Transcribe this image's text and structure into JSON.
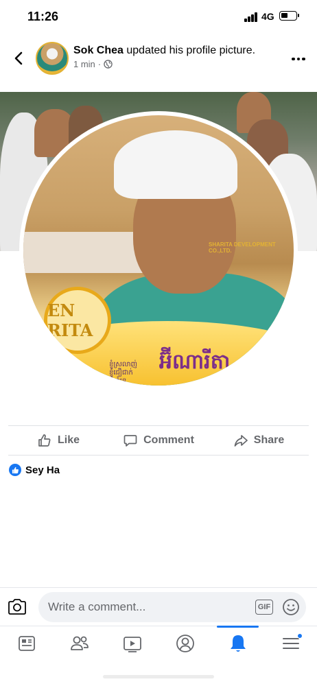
{
  "status_bar": {
    "time": "11:26",
    "network": "4G"
  },
  "post": {
    "author": "Sok Chea",
    "action_text": " updated his profile picture.",
    "time_ago": "1 min",
    "separator": "·",
    "privacy_icon": "globe-icon"
  },
  "photo": {
    "logo_text": "EN RITA",
    "tagline_lines": [
      "ខ្ញុំស្រលាញ់",
      "ខ្ញុំជឿជាក់",
      "ខ្ញុំគាំទ្រ"
    ],
    "brand": "អ៊ីណារីតា",
    "watermark": "SHARITA DEVELOPMENT CO.,LTD."
  },
  "actions": [
    {
      "label": "Like",
      "icon": "thumbs-up-icon"
    },
    {
      "label": "Comment",
      "icon": "comment-icon"
    },
    {
      "label": "Share",
      "icon": "share-icon"
    }
  ],
  "reactions": {
    "names": "Sey Ha",
    "icon": "like-badge-icon"
  },
  "comment": {
    "placeholder": "Write a comment...",
    "gif_label": "GIF"
  },
  "tabs": [
    {
      "icon": "news-feed-icon"
    },
    {
      "icon": "friends-icon"
    },
    {
      "icon": "watch-icon"
    },
    {
      "icon": "profile-icon"
    },
    {
      "icon": "notifications-bell-icon",
      "active": true
    },
    {
      "icon": "menu-icon",
      "badge": true
    }
  ],
  "colors": {
    "accent": "#1877f2",
    "secondary_text": "#65676b",
    "divider": "#dfe1e5"
  }
}
